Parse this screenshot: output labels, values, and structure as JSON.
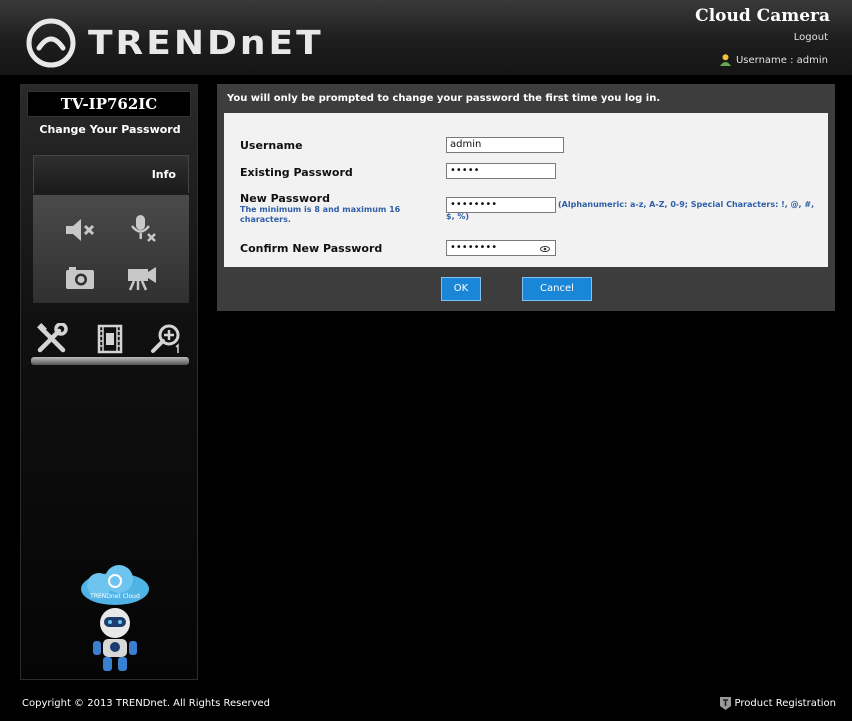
{
  "header": {
    "logo_text": "TRENDnET",
    "product": "Cloud Camera",
    "logout": "Logout",
    "username_line": "Username : admin"
  },
  "sidebar": {
    "model": "TV-IP762IC",
    "menu_item": "Change Your Password",
    "info_tab": "Info",
    "controls": [
      "speaker-mute-icon",
      "microphone-mute-icon",
      "snapshot-camera-icon",
      "video-record-icon"
    ],
    "tools": [
      "settings-tools-icon",
      "film-gallery-icon",
      "zoom-in-icon"
    ],
    "mascot_label": "TRENDnet Cloud"
  },
  "main": {
    "prompt": "You will only be prompted to change your password the first time you log in.",
    "fields": {
      "username_label": "Username",
      "username_value": "admin",
      "existing_label": "Existing Password",
      "existing_value": "•••••",
      "new_label": "New Password",
      "new_note": "The minimum is 8 and maximum 16 characters.",
      "new_value": "••••••••",
      "new_hint": "(Alphanumeric: a-z, A-Z, 0-9; Special Characters: !, @, #, $, %)",
      "confirm_label": "Confirm New Password",
      "confirm_value": "••••••••"
    },
    "buttons": {
      "ok": "OK",
      "cancel": "Cancel"
    }
  },
  "footer": {
    "copyright": "Copyright © 2013 TRENDnet. All Rights Reserved",
    "product_registration": "Product Registration"
  }
}
